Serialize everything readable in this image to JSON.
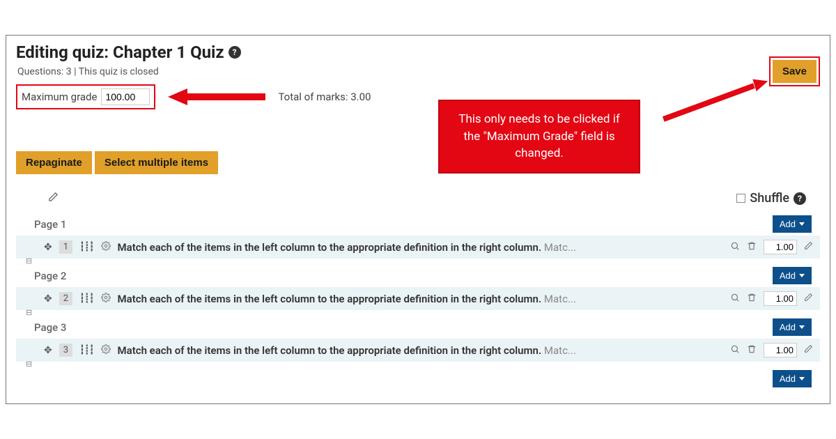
{
  "header": {
    "title": "Editing quiz: Chapter 1 Quiz",
    "subtitle": "Questions: 3 | This quiz is closed"
  },
  "max_grade": {
    "label": "Maximum grade",
    "value": "100.00"
  },
  "total_marks": "Total of marks: 3.00",
  "save_label": "Save",
  "callout_text": "This only needs to be clicked if the \"Maximum Grade\" field is changed.",
  "buttons": {
    "repaginate": "Repaginate",
    "select_multiple": "Select multiple items"
  },
  "shuffle_label": "Shuffle",
  "add_label": "Add",
  "pages": [
    {
      "label": "Page 1",
      "num": "1",
      "text_bold": "Match each of the items in the left column to the appropriate definition in the right column.",
      "text_tail": " Matc...",
      "mark": "1.00"
    },
    {
      "label": "Page 2",
      "num": "2",
      "text_bold": "Match each of the items in the left column to the appropriate definition in the right column.",
      "text_tail": " Matc...",
      "mark": "1.00"
    },
    {
      "label": "Page 3",
      "num": "3",
      "text_bold": "Match each of the items in the left column to the appropriate definition in the right column.",
      "text_tail": " Matc...",
      "mark": "1.00"
    }
  ]
}
